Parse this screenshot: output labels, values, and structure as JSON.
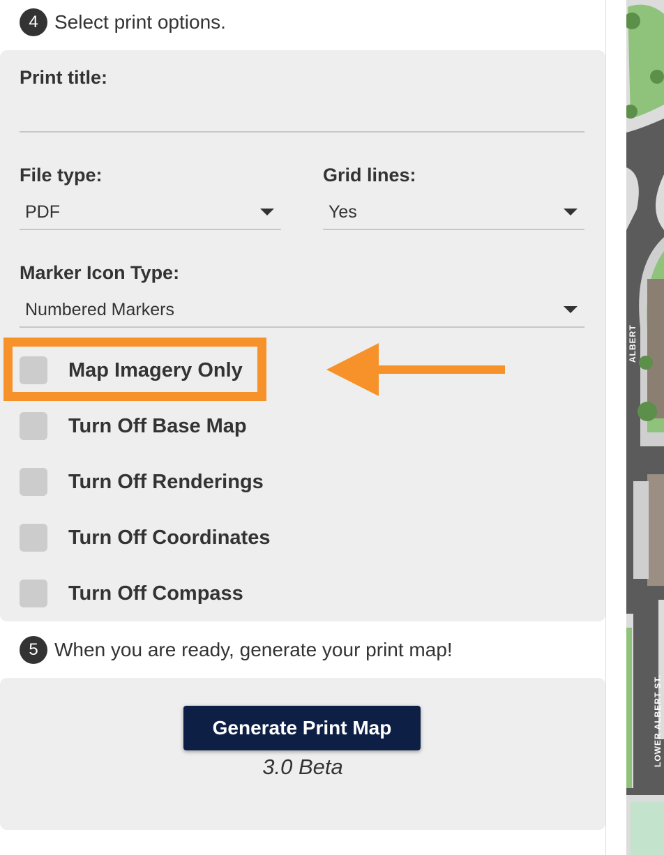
{
  "step4": {
    "number": "4",
    "text": "Select print options."
  },
  "print_title": {
    "label": "Print title:",
    "value": ""
  },
  "file_type": {
    "label": "File type:",
    "value": "PDF"
  },
  "grid_lines": {
    "label": "Grid lines:",
    "value": "Yes"
  },
  "marker_icon_type": {
    "label": "Marker Icon Type:",
    "value": "Numbered Markers"
  },
  "checkboxes": [
    {
      "label": "Map Imagery Only",
      "checked": false
    },
    {
      "label": "Turn Off Base Map",
      "checked": false
    },
    {
      "label": "Turn Off Renderings",
      "checked": false
    },
    {
      "label": "Turn Off Coordinates",
      "checked": false
    },
    {
      "label": "Turn Off Compass",
      "checked": false
    }
  ],
  "step5": {
    "number": "5",
    "text": "When you are ready, generate your print map!"
  },
  "generate_button": {
    "label": "Generate Print Map"
  },
  "version": "3.0 Beta",
  "map": {
    "street_labels": [
      "ALBERT",
      "LOWER ALBERT ST."
    ]
  },
  "colors": {
    "highlight": "#f7922a",
    "button_bg": "#0d1f45",
    "panel_bg": "#eeeeee",
    "checkbox": "#cccccc"
  }
}
